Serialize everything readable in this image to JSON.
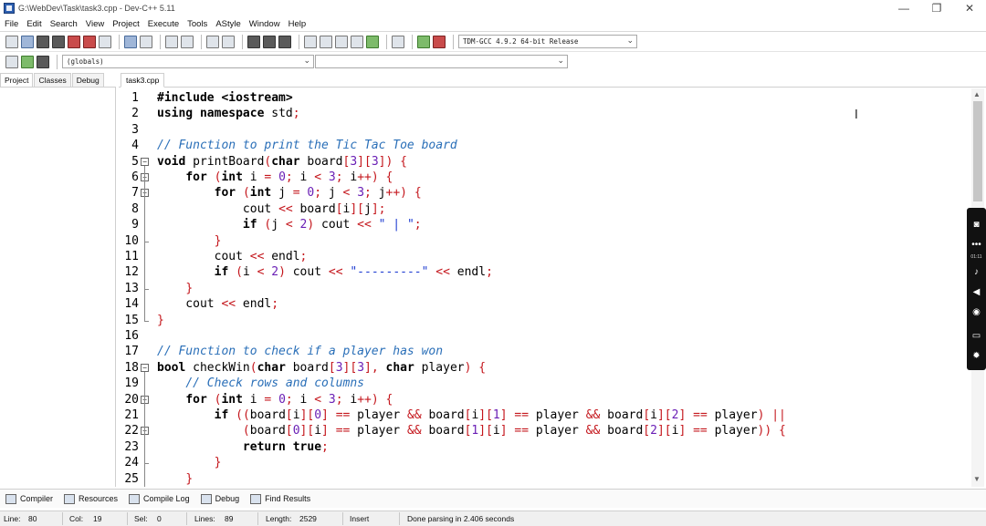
{
  "window": {
    "title": "G:\\WebDev\\Task\\task3.cpp - Dev-C++ 5.11",
    "controls": [
      "—",
      "❐",
      "✕"
    ]
  },
  "menu": [
    "File",
    "Edit",
    "Search",
    "View",
    "Project",
    "Execute",
    "Tools",
    "AStyle",
    "Window",
    "Help"
  ],
  "toolbar": {
    "compiler_select": "TDM-GCC 4.9.2 64-bit Release",
    "scope_select": "(globals)",
    "symbol_select": ""
  },
  "left_panel": {
    "tabs": [
      "Project",
      "Classes",
      "Debug"
    ],
    "active_tab": "Project"
  },
  "editor": {
    "file_tab": "task3.cpp",
    "lines": [
      {
        "n": "1"
      },
      {
        "n": "2"
      },
      {
        "n": "3"
      },
      {
        "n": "4"
      },
      {
        "n": "5"
      },
      {
        "n": "6"
      },
      {
        "n": "7"
      },
      {
        "n": "8"
      },
      {
        "n": "9"
      },
      {
        "n": "10"
      },
      {
        "n": "11"
      },
      {
        "n": "12"
      },
      {
        "n": "13"
      },
      {
        "n": "14"
      },
      {
        "n": "15"
      },
      {
        "n": "16"
      },
      {
        "n": "17"
      },
      {
        "n": "18"
      },
      {
        "n": "19"
      },
      {
        "n": "20"
      },
      {
        "n": "21"
      },
      {
        "n": "22"
      },
      {
        "n": "23"
      },
      {
        "n": "24"
      },
      {
        "n": "25"
      }
    ],
    "code": [
      "#include <iostream>",
      "using namespace std;",
      "",
      "// Function to print the Tic Tac Toe board",
      "void printBoard(char board[3][3]) {",
      "    for (int i = 0; i < 3; i++) {",
      "        for (int j = 0; j < 3; j++) {",
      "            cout << board[i][j];",
      "            if (j < 2) cout << \" | \";",
      "        }",
      "        cout << endl;",
      "        if (i < 2) cout << \"---------\" << endl;",
      "    }",
      "    cout << endl;",
      "}",
      "",
      "// Function to check if a player has won",
      "bool checkWin(char board[3][3], char player) {",
      "    // Check rows and columns",
      "    for (int i = 0; i < 3; i++) {",
      "        if ((board[i][0] == player && board[i][1] == player && board[i][2] == player) ||",
      "            (board[0][i] == player && board[1][i] == player && board[2][i] == player)) {",
      "            return true;",
      "        }",
      "    }"
    ]
  },
  "bottom_tabs": [
    "Compiler",
    "Resources",
    "Compile Log",
    "Debug",
    "Find Results"
  ],
  "status": {
    "line_label": "Line:",
    "line_value": "80",
    "col_label": "Col:",
    "col_value": "19",
    "sel_label": "Sel:",
    "sel_value": "0",
    "lines_label": "Lines:",
    "lines_value": "89",
    "length_label": "Length:",
    "length_value": "2529",
    "mode": "Insert",
    "message": "Done parsing in 2.406 seconds"
  },
  "recorder": {
    "time": "01:11"
  }
}
